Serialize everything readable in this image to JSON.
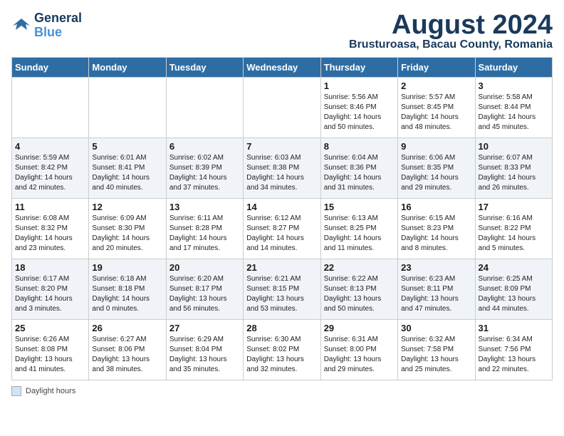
{
  "header": {
    "logo_line1": "General",
    "logo_line2": "Blue",
    "month": "August 2024",
    "location": "Brusturoasa, Bacau County, Romania"
  },
  "days_of_week": [
    "Sunday",
    "Monday",
    "Tuesday",
    "Wednesday",
    "Thursday",
    "Friday",
    "Saturday"
  ],
  "weeks": [
    [
      {
        "day": "",
        "info": ""
      },
      {
        "day": "",
        "info": ""
      },
      {
        "day": "",
        "info": ""
      },
      {
        "day": "",
        "info": ""
      },
      {
        "day": "1",
        "info": "Sunrise: 5:56 AM\nSunset: 8:46 PM\nDaylight: 14 hours\nand 50 minutes."
      },
      {
        "day": "2",
        "info": "Sunrise: 5:57 AM\nSunset: 8:45 PM\nDaylight: 14 hours\nand 48 minutes."
      },
      {
        "day": "3",
        "info": "Sunrise: 5:58 AM\nSunset: 8:44 PM\nDaylight: 14 hours\nand 45 minutes."
      }
    ],
    [
      {
        "day": "4",
        "info": "Sunrise: 5:59 AM\nSunset: 8:42 PM\nDaylight: 14 hours\nand 42 minutes."
      },
      {
        "day": "5",
        "info": "Sunrise: 6:01 AM\nSunset: 8:41 PM\nDaylight: 14 hours\nand 40 minutes."
      },
      {
        "day": "6",
        "info": "Sunrise: 6:02 AM\nSunset: 8:39 PM\nDaylight: 14 hours\nand 37 minutes."
      },
      {
        "day": "7",
        "info": "Sunrise: 6:03 AM\nSunset: 8:38 PM\nDaylight: 14 hours\nand 34 minutes."
      },
      {
        "day": "8",
        "info": "Sunrise: 6:04 AM\nSunset: 8:36 PM\nDaylight: 14 hours\nand 31 minutes."
      },
      {
        "day": "9",
        "info": "Sunrise: 6:06 AM\nSunset: 8:35 PM\nDaylight: 14 hours\nand 29 minutes."
      },
      {
        "day": "10",
        "info": "Sunrise: 6:07 AM\nSunset: 8:33 PM\nDaylight: 14 hours\nand 26 minutes."
      }
    ],
    [
      {
        "day": "11",
        "info": "Sunrise: 6:08 AM\nSunset: 8:32 PM\nDaylight: 14 hours\nand 23 minutes."
      },
      {
        "day": "12",
        "info": "Sunrise: 6:09 AM\nSunset: 8:30 PM\nDaylight: 14 hours\nand 20 minutes."
      },
      {
        "day": "13",
        "info": "Sunrise: 6:11 AM\nSunset: 8:28 PM\nDaylight: 14 hours\nand 17 minutes."
      },
      {
        "day": "14",
        "info": "Sunrise: 6:12 AM\nSunset: 8:27 PM\nDaylight: 14 hours\nand 14 minutes."
      },
      {
        "day": "15",
        "info": "Sunrise: 6:13 AM\nSunset: 8:25 PM\nDaylight: 14 hours\nand 11 minutes."
      },
      {
        "day": "16",
        "info": "Sunrise: 6:15 AM\nSunset: 8:23 PM\nDaylight: 14 hours\nand 8 minutes."
      },
      {
        "day": "17",
        "info": "Sunrise: 6:16 AM\nSunset: 8:22 PM\nDaylight: 14 hours\nand 5 minutes."
      }
    ],
    [
      {
        "day": "18",
        "info": "Sunrise: 6:17 AM\nSunset: 8:20 PM\nDaylight: 14 hours\nand 3 minutes."
      },
      {
        "day": "19",
        "info": "Sunrise: 6:18 AM\nSunset: 8:18 PM\nDaylight: 14 hours\nand 0 minutes."
      },
      {
        "day": "20",
        "info": "Sunrise: 6:20 AM\nSunset: 8:17 PM\nDaylight: 13 hours\nand 56 minutes."
      },
      {
        "day": "21",
        "info": "Sunrise: 6:21 AM\nSunset: 8:15 PM\nDaylight: 13 hours\nand 53 minutes."
      },
      {
        "day": "22",
        "info": "Sunrise: 6:22 AM\nSunset: 8:13 PM\nDaylight: 13 hours\nand 50 minutes."
      },
      {
        "day": "23",
        "info": "Sunrise: 6:23 AM\nSunset: 8:11 PM\nDaylight: 13 hours\nand 47 minutes."
      },
      {
        "day": "24",
        "info": "Sunrise: 6:25 AM\nSunset: 8:09 PM\nDaylight: 13 hours\nand 44 minutes."
      }
    ],
    [
      {
        "day": "25",
        "info": "Sunrise: 6:26 AM\nSunset: 8:08 PM\nDaylight: 13 hours\nand 41 minutes."
      },
      {
        "day": "26",
        "info": "Sunrise: 6:27 AM\nSunset: 8:06 PM\nDaylight: 13 hours\nand 38 minutes."
      },
      {
        "day": "27",
        "info": "Sunrise: 6:29 AM\nSunset: 8:04 PM\nDaylight: 13 hours\nand 35 minutes."
      },
      {
        "day": "28",
        "info": "Sunrise: 6:30 AM\nSunset: 8:02 PM\nDaylight: 13 hours\nand 32 minutes."
      },
      {
        "day": "29",
        "info": "Sunrise: 6:31 AM\nSunset: 8:00 PM\nDaylight: 13 hours\nand 29 minutes."
      },
      {
        "day": "30",
        "info": "Sunrise: 6:32 AM\nSunset: 7:58 PM\nDaylight: 13 hours\nand 25 minutes."
      },
      {
        "day": "31",
        "info": "Sunrise: 6:34 AM\nSunset: 7:56 PM\nDaylight: 13 hours\nand 22 minutes."
      }
    ]
  ],
  "footer": {
    "legend_label": "Daylight hours"
  }
}
